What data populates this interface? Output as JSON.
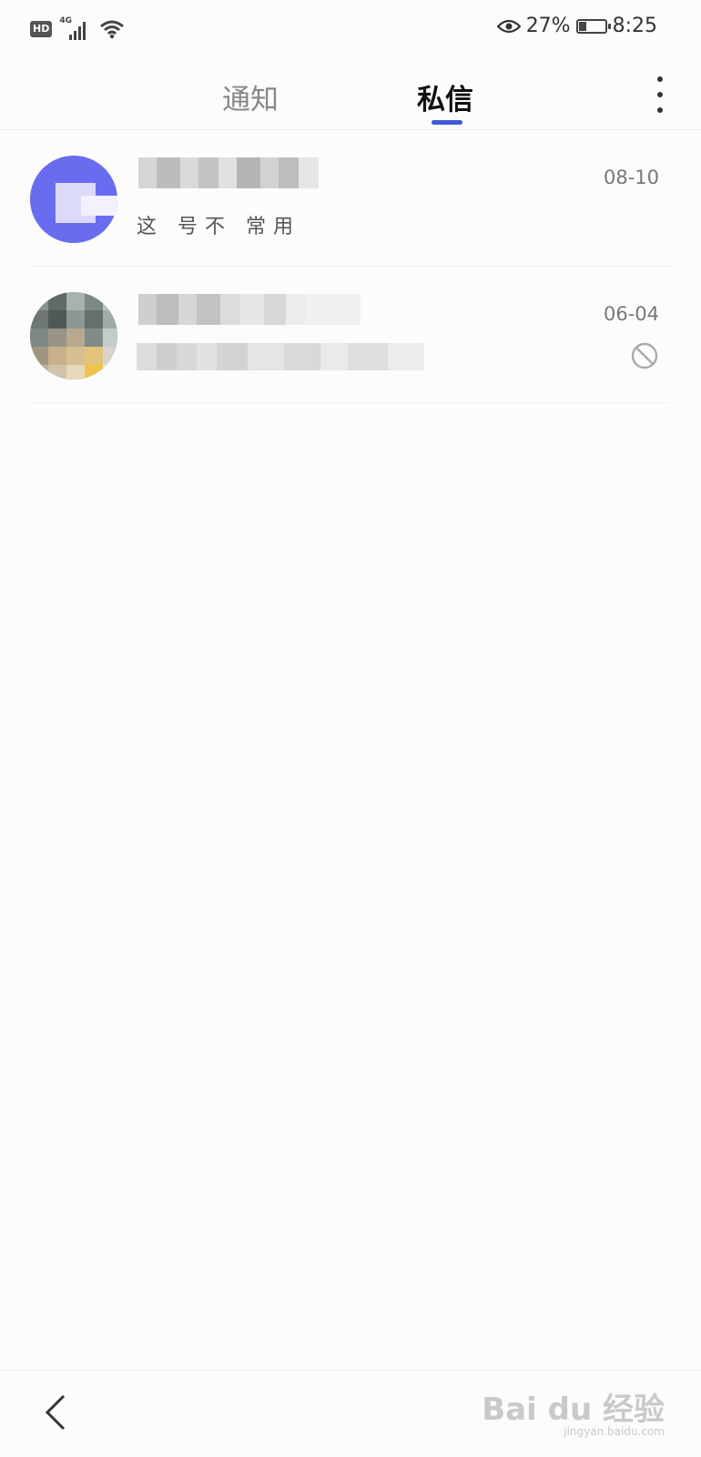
{
  "status_bar": {
    "hd": "HD",
    "network": "4G",
    "battery_text": "27%",
    "battery_level": 0.27,
    "time": "8:25"
  },
  "tabs": [
    {
      "label": "通知",
      "active": false
    },
    {
      "label": "私信",
      "active": true
    }
  ],
  "accent_color": "#3b5bd9",
  "messages": [
    {
      "name": "",
      "preview": "这 号不 常用",
      "date": "08-10",
      "avatar_color": "#6a6cf0",
      "blocked": false
    },
    {
      "name": "",
      "preview": "",
      "date": "06-04",
      "avatar_color": "#7a8380",
      "blocked": true
    }
  ],
  "icons": {
    "more": "more-vertical-icon",
    "block": "block-icon",
    "back": "back-arrow-icon",
    "eye": "eye-icon",
    "wifi": "wifi-icon",
    "signal": "signal-icon",
    "battery": "battery-icon"
  },
  "watermark": {
    "main": "Bai du 经验",
    "sub": "jingyan.baidu.com"
  }
}
